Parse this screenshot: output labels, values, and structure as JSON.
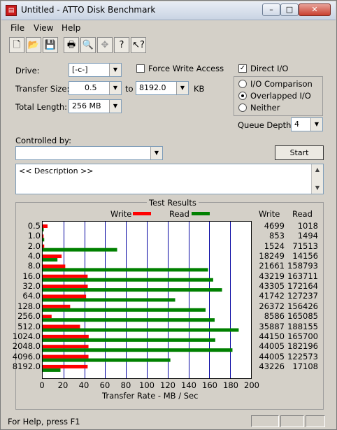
{
  "window": {
    "title": "Untitled - ATTO Disk Benchmark",
    "app_icon": "atto-icon"
  },
  "window_buttons": {
    "minimize": "–",
    "maximize": "□",
    "close": "✕"
  },
  "menu": [
    "File",
    "View",
    "Help"
  ],
  "toolbar_icons": [
    "new-icon",
    "open-icon",
    "save-icon",
    "print-icon",
    "print-preview-icon",
    "move-icon",
    "help-icon",
    "context-help-icon"
  ],
  "form": {
    "drive_label": "Drive:",
    "drive_value": "[-c-]",
    "force_write_label": "Force Write Access",
    "force_write_checked": false,
    "direct_io_label": "Direct I/O",
    "direct_io_checked": true,
    "transfer_size_label": "Transfer Size:",
    "transfer_from": "0.5",
    "transfer_to_label": "to",
    "transfer_to": "8192.0",
    "kb_label": "KB",
    "total_length_label": "Total Length:",
    "total_length_value": "256 MB",
    "io_options": [
      "I/O Comparison",
      "Overlapped I/O",
      "Neither"
    ],
    "io_selected": "Overlapped I/O",
    "queue_depth_label": "Queue Depth:",
    "queue_depth_value": "4",
    "controlled_by_label": "Controlled by:",
    "controlled_by_value": "",
    "start_label": "Start",
    "description_text": "<< Description >>"
  },
  "results": {
    "group_title": "Test Results",
    "write_legend": "Write",
    "read_legend": "Read",
    "write_col": "Write",
    "read_col": "Read",
    "write_color": "#ff0000",
    "read_color": "#008000"
  },
  "chart_data": {
    "type": "bar",
    "orientation": "horizontal",
    "xlabel": "Transfer Rate - MB / Sec",
    "xlim": [
      0,
      200
    ],
    "xticks": [
      "0",
      "20",
      "40",
      "60",
      "80",
      "100",
      "120",
      "140",
      "160",
      "180",
      "200"
    ],
    "categories": [
      "0.5",
      "1.0",
      "2.0",
      "4.0",
      "8.0",
      "16.0",
      "32.0",
      "64.0",
      "128.0",
      "256.0",
      "512.0",
      "1024.0",
      "2048.0",
      "4096.0",
      "8192.0"
    ],
    "series": [
      {
        "name": "Write",
        "color": "#ff0000",
        "values": [
          4.7,
          0.9,
          1.5,
          18.2,
          21.7,
          43.2,
          43.3,
          41.7,
          26.4,
          8.6,
          35.9,
          44.2,
          44.0,
          44.0,
          43.2
        ]
      },
      {
        "name": "Read",
        "color": "#008000",
        "values": [
          1.0,
          1.5,
          71.5,
          14.2,
          158.8,
          163.7,
          172.2,
          127.2,
          156.4,
          165.1,
          188.2,
          165.7,
          182.2,
          122.6,
          17.1
        ]
      }
    ],
    "write_values_text": [
      "4699",
      "853",
      "1524",
      "18249",
      "21661",
      "43219",
      "43305",
      "41742",
      "26372",
      "8586",
      "35887",
      "44150",
      "44005",
      "44005",
      "43226"
    ],
    "read_values_text": [
      "1018",
      "1494",
      "71513",
      "14156",
      "158793",
      "163711",
      "172164",
      "127237",
      "156426",
      "165085",
      "188155",
      "165700",
      "182196",
      "122573",
      "17108"
    ]
  },
  "status": {
    "text": "For Help, press F1"
  }
}
